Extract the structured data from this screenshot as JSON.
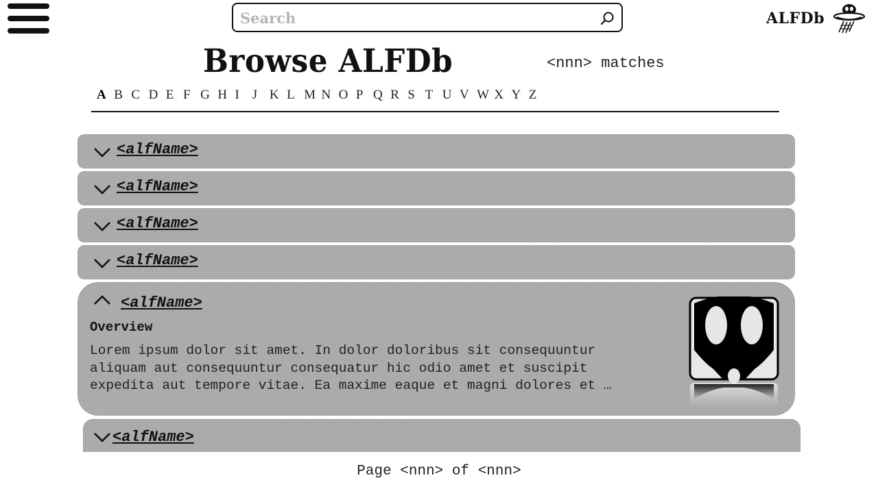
{
  "header": {
    "menu_icon": "hamburger-menu-icon",
    "search": {
      "placeholder": "Search",
      "value": "",
      "icon": "search-icon"
    },
    "brand": {
      "name": "ALFDb",
      "logo": "alien-ufo-logo"
    }
  },
  "title": {
    "text": "Browse ALFDb",
    "matches": "<nnn> matches"
  },
  "alphabet": {
    "active": "A",
    "letters": [
      "A",
      "B",
      "C",
      "D",
      "E",
      "F",
      "G",
      "H",
      "I",
      "J",
      "K",
      "L",
      "M",
      "N",
      "O",
      "P",
      "Q",
      "R",
      "S",
      "T",
      "U",
      "V",
      "W",
      "X",
      "Y",
      "Z"
    ]
  },
  "results": {
    "items": [
      {
        "name": "<alfName>",
        "expanded": false,
        "icon": "chevron-down-icon"
      },
      {
        "name": "<alfName>",
        "expanded": false,
        "icon": "chevron-down-icon"
      },
      {
        "name": "<alfName>",
        "expanded": false,
        "icon": "chevron-down-icon"
      },
      {
        "name": "<alfName>",
        "expanded": false,
        "icon": "chevron-down-icon"
      },
      {
        "name": "<alfName>",
        "expanded": true,
        "icon": "chevron-up-icon",
        "overview_label": "Overview",
        "overview_text": "Lorem ipsum dolor sit amet. In dolor doloribus sit consequuntur\naliquam aut consequuntur consequatur hic odio amet et suscipit\nexpedita aut tempore vitae. Ea maxime eaque et magni dolores et …",
        "thumbnail_icon": "alien-skull-thumbnail"
      },
      {
        "name": "<alfName>",
        "expanded": false,
        "icon": "chevron-down-icon"
      }
    ]
  },
  "pagination": {
    "text": "Page <nnn> of <nnn>"
  },
  "colors": {
    "row_bg": "#ababab",
    "text": "#111111",
    "placeholder": "#b5b5b5"
  }
}
